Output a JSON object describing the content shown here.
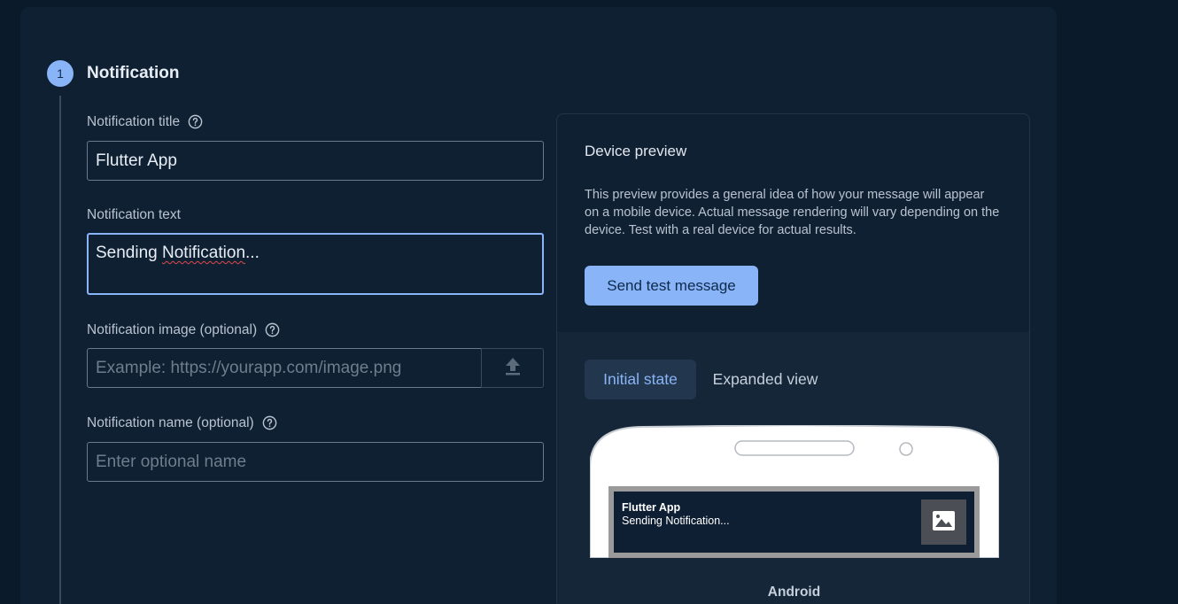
{
  "step": {
    "number": "1",
    "title": "Notification"
  },
  "form": {
    "title_label": "Notification title",
    "title_value": "Flutter App",
    "text_label": "Notification text",
    "text_value_pre": "Sending ",
    "text_value_misspelled": "Notification",
    "text_value_post": "...",
    "image_label": "Notification image (optional)",
    "image_placeholder": "Example: https://yourapp.com/image.png",
    "name_label": "Notification name (optional)",
    "name_placeholder": "Enter optional name"
  },
  "preview": {
    "title": "Device preview",
    "description": "This preview provides a general idea of how your message will appear on a mobile device. Actual message rendering will vary depending on the device. Test with a real device for actual results.",
    "send_button": "Send test message",
    "tabs": [
      {
        "label": "Initial state",
        "active": true
      },
      {
        "label": "Expanded view",
        "active": false
      }
    ],
    "notification_title": "Flutter App",
    "notification_text": "Sending Notification...",
    "platform": "Android"
  },
  "icons": [
    "help-icon",
    "upload-icon",
    "image-icon"
  ],
  "colors": {
    "accent": "#8ab4f8",
    "background": "#0a1a2b",
    "card": "#102033",
    "spellcheck": "#e04a4a"
  }
}
